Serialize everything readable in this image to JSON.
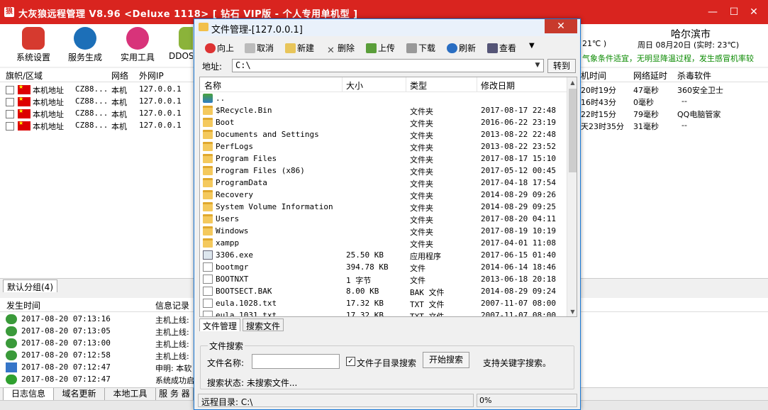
{
  "main": {
    "title": "大灰狼远程管理 V8.96 <Deluxe 1118> [ 钻石 VIP版 - 个人专用单机型 ]",
    "window_controls": {
      "minimize": "—",
      "maximize": "☐",
      "close": "✕"
    },
    "toolbar": [
      {
        "label": "系统设置",
        "icon": "pinterest-icon",
        "color": "#d63a2f"
      },
      {
        "label": "服务生成",
        "icon": "package-icon",
        "color": "#1c6fb8"
      },
      {
        "label": "实用工具",
        "icon": "dribbble-icon",
        "color": "#d8337a"
      },
      {
        "label": "DDOS",
        "icon": "image-icon",
        "color": "#8bb33a"
      }
    ],
    "weather": {
      "city": "哈尔滨市",
      "temp": "21℃ )",
      "date": "周日 08月20日 (实时: 23℃)",
      "tip": "气象条件适宜，无明显降温过程，发生感冒机率较"
    },
    "host_columns": {
      "flag": "旗帜/区域",
      "network": "网络",
      "wan_ip": "外网IP",
      "uptime": "机时间",
      "latency": "网络延时",
      "antivirus": "杀毒软件"
    },
    "hosts": [
      {
        "area": "本机地址",
        "cz": "CZ88...",
        "net": "本机",
        "ip": "127.0.0.1",
        "uptime": "20时19分",
        "latency": "47毫秒",
        "av": "360安全卫士"
      },
      {
        "area": "本机地址",
        "cz": "CZ88...",
        "net": "本机",
        "ip": "127.0.0.1",
        "uptime": "16时43分",
        "latency": "0毫秒",
        "av": "--"
      },
      {
        "area": "本机地址",
        "cz": "CZ88...",
        "net": "本机",
        "ip": "127.0.0.1",
        "uptime": "22时15分",
        "latency": "79毫秒",
        "av": "QQ电脑管家"
      },
      {
        "area": "本机地址",
        "cz": "CZ88...",
        "net": "本机",
        "ip": "127.0.0.1",
        "uptime": "天23时35分",
        "latency": "31毫秒",
        "av": "--"
      }
    ],
    "group_tab": "默认分组(4)",
    "log_columns": {
      "time": "发生时间",
      "info": "信息记录"
    },
    "logs": [
      {
        "time": "2017-08-20 07:13:16",
        "info": "主机上线:",
        "icon": "user-online-icon"
      },
      {
        "time": "2017-08-20 07:13:05",
        "info": "主机上线:",
        "icon": "user-online-icon"
      },
      {
        "time": "2017-08-20 07:13:00",
        "info": "主机上线:",
        "icon": "user-online-icon"
      },
      {
        "time": "2017-08-20 07:12:58",
        "info": "主机上线:",
        "icon": "user-online-icon"
      },
      {
        "time": "2017-08-20 07:12:47",
        "info": "申明: 本软",
        "icon": "flag-icon"
      },
      {
        "time": "2017-08-20 07:12:47",
        "info": "系统成功启",
        "icon": "check-icon"
      }
    ],
    "bottom_tabs": [
      "日志信息",
      "域名更新",
      "本地工具",
      "服 务 器"
    ]
  },
  "fm": {
    "title": "文件管理-[127.0.0.1]",
    "close": "✕",
    "toolbar": [
      {
        "label": "向上",
        "icon": "up-arrow-icon",
        "color": "#d33"
      },
      {
        "label": "取消",
        "icon": "cancel-icon",
        "color": "#bbb"
      },
      {
        "label": "新建",
        "icon": "new-icon",
        "color": "#e8c55a"
      },
      {
        "label": "删除",
        "icon": "delete-icon",
        "color": "#777"
      },
      {
        "label": "上传",
        "icon": "upload-icon",
        "color": "#5a9e3a"
      },
      {
        "label": "下载",
        "icon": "download-icon",
        "color": "#999"
      },
      {
        "label": "刷新",
        "icon": "refresh-icon",
        "color": "#2a6ec2"
      },
      {
        "label": "查看",
        "icon": "view-icon",
        "color": "#557"
      },
      {
        "label": "▼",
        "icon": "dropdown-icon",
        "color": "transparent"
      }
    ],
    "address_label": "地址:",
    "address_value": "C:\\",
    "goto_label": "转到",
    "columns": {
      "name": "名称",
      "size": "大小",
      "type": "类型",
      "modified": "修改日期"
    },
    "files": [
      {
        "name": "..",
        "size": "",
        "type": "",
        "modified": "",
        "kind": "up"
      },
      {
        "name": "$Recycle.Bin",
        "size": "",
        "type": "文件夹",
        "modified": "2017-08-17 22:48",
        "kind": "folder"
      },
      {
        "name": "Boot",
        "size": "",
        "type": "文件夹",
        "modified": "2016-06-22 23:19",
        "kind": "folder"
      },
      {
        "name": "Documents and Settings",
        "size": "",
        "type": "文件夹",
        "modified": "2013-08-22 22:48",
        "kind": "folder"
      },
      {
        "name": "PerfLogs",
        "size": "",
        "type": "文件夹",
        "modified": "2013-08-22 23:52",
        "kind": "folder"
      },
      {
        "name": "Program Files",
        "size": "",
        "type": "文件夹",
        "modified": "2017-08-17 15:10",
        "kind": "folder"
      },
      {
        "name": "Program Files (x86)",
        "size": "",
        "type": "文件夹",
        "modified": "2017-05-12 00:45",
        "kind": "folder"
      },
      {
        "name": "ProgramData",
        "size": "",
        "type": "文件夹",
        "modified": "2017-04-18 17:54",
        "kind": "folder"
      },
      {
        "name": "Recovery",
        "size": "",
        "type": "文件夹",
        "modified": "2014-08-29 09:26",
        "kind": "folder"
      },
      {
        "name": "System Volume Information",
        "size": "",
        "type": "文件夹",
        "modified": "2014-08-29 09:25",
        "kind": "folder"
      },
      {
        "name": "Users",
        "size": "",
        "type": "文件夹",
        "modified": "2017-08-20 04:11",
        "kind": "folder"
      },
      {
        "name": "Windows",
        "size": "",
        "type": "文件夹",
        "modified": "2017-08-19 10:19",
        "kind": "folder"
      },
      {
        "name": "xampp",
        "size": "",
        "type": "文件夹",
        "modified": "2017-04-01 11:08",
        "kind": "folder"
      },
      {
        "name": "3306.exe",
        "size": "25.50 KB",
        "type": "应用程序",
        "modified": "2017-06-15 01:40",
        "kind": "exe"
      },
      {
        "name": "bootmgr",
        "size": "394.78 KB",
        "type": "文件",
        "modified": "2014-06-14 18:46",
        "kind": "file"
      },
      {
        "name": "BOOTNXT",
        "size": "1 字节",
        "type": "文件",
        "modified": "2013-06-18 20:18",
        "kind": "file"
      },
      {
        "name": "BOOTSECT.BAK",
        "size": "8.00 KB",
        "type": "BAK 文件",
        "modified": "2014-08-29 09:24",
        "kind": "file"
      },
      {
        "name": "eula.1028.txt",
        "size": "17.32 KB",
        "type": "TXT 文件",
        "modified": "2007-11-07 08:00",
        "kind": "file"
      },
      {
        "name": "eula.1031.txt",
        "size": "17.32 KB",
        "type": "TXT 文件",
        "modified": "2007-11-07 08:00",
        "kind": "file"
      }
    ],
    "tabs": [
      "文件管理",
      "搜索文件"
    ],
    "search": {
      "group_title": "文件搜索",
      "name_label": "文件名称:",
      "name_value": "",
      "subdir_label": "文件子目录搜索",
      "subdir_checked": "✓",
      "start_label": "开始搜索",
      "hint": "支持关键字搜索。",
      "status": "搜索状态:  未搜索文件..."
    },
    "status_left": "远程目录: C:\\",
    "status_right": "0%"
  }
}
